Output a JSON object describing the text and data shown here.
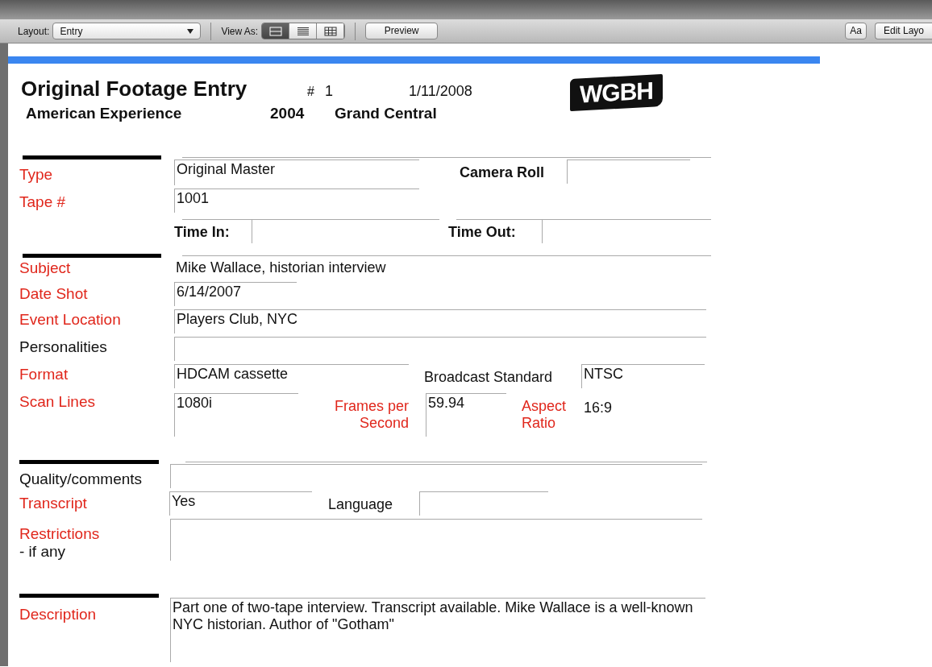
{
  "toolbar": {
    "layout_label": "Layout:",
    "layout_value": "Entry",
    "view_as_label": "View As:",
    "view_buttons": [
      {
        "kind": "form",
        "selected": true
      },
      {
        "kind": "list",
        "selected": false
      },
      {
        "kind": "table",
        "selected": false
      }
    ],
    "preview": "Preview",
    "text_button": "Aa",
    "edit_layout": "Edit Layo"
  },
  "header": {
    "title": "Original Footage Entry",
    "number_mark": "#",
    "number": "1",
    "date": "1/11/2008",
    "logo": "WGBH",
    "series": "American Experience",
    "year": "2004",
    "program": "Grand Central"
  },
  "rows": [
    {
      "label": "Type",
      "color": "#e0261b",
      "cells": [
        {
          "kind": "field",
          "value": "Original Master"
        },
        {
          "kind": "caption",
          "text": "Camera Roll",
          "bold": true,
          "color": "#111111"
        },
        {
          "kind": "field"
        }
      ]
    },
    {
      "label": "Tape #",
      "color": "#e0261b",
      "cells": [
        {
          "kind": "field",
          "value": "1001"
        }
      ]
    },
    {
      "cells": [
        {
          "kind": "caption",
          "text": "Time In:",
          "bold": true,
          "color": "#111111"
        },
        {
          "kind": "field"
        },
        {
          "kind": "caption",
          "text": "Time Out:",
          "bold": true,
          "color": "#111111"
        },
        {
          "kind": "field"
        }
      ]
    },
    {
      "label": "Subject",
      "color": "#e0261b",
      "cells": [
        {
          "kind": "text",
          "value": "Mike Wallace, historian interview"
        }
      ]
    },
    {
      "label": "Date Shot",
      "color": "#e0261b",
      "cells": [
        {
          "kind": "field",
          "value": "6/14/2007"
        }
      ]
    },
    {
      "label": "Event Location",
      "color": "#e0261b",
      "cells": [
        {
          "kind": "field",
          "value": "Players Club, NYC"
        }
      ]
    },
    {
      "label": "Personalities",
      "color": "#111111",
      "cells": [
        {
          "kind": "field"
        }
      ]
    },
    {
      "label": "Format",
      "color": "#e0261b",
      "cells": [
        {
          "kind": "field",
          "value": "HDCAM cassette"
        },
        {
          "kind": "caption",
          "text": "Broadcast Standard",
          "bold": false,
          "color": "#111111"
        },
        {
          "kind": "field",
          "value": "NTSC"
        }
      ]
    },
    {
      "label": "Scan Lines",
      "color": "#e0261b",
      "cells": [
        {
          "kind": "field",
          "value": "1080i"
        },
        {
          "kind": "caption",
          "text": "Frames per Second",
          "bold": false,
          "color": "#e0261b"
        },
        {
          "kind": "field",
          "value": "59.94"
        },
        {
          "kind": "caption",
          "text": "Aspect Ratio",
          "bold": false,
          "color": "#e0261b"
        },
        {
          "kind": "text",
          "value": "16:9"
        }
      ]
    },
    {
      "label": "Quality/comments",
      "color": "#111111",
      "cells": [
        {
          "kind": "field"
        }
      ]
    },
    {
      "label": "Transcript",
      "color": "#e0261b",
      "cells": [
        {
          "kind": "field",
          "value": "Yes"
        },
        {
          "kind": "caption",
          "text": "Language",
          "bold": false,
          "color": "#111111"
        },
        {
          "kind": "field"
        }
      ]
    },
    {
      "label": "Restrictions",
      "note": "- if any",
      "color": "#e0261b",
      "cells": [
        {
          "kind": "field"
        }
      ]
    },
    {
      "label": "Description",
      "color": "#e0261b",
      "cells": [
        {
          "kind": "field",
          "value": "Part one of two-tape interview. Transcript available. Mike Wallace is a well-known NYC historian. Author of \"Gotham\""
        }
      ]
    }
  ]
}
